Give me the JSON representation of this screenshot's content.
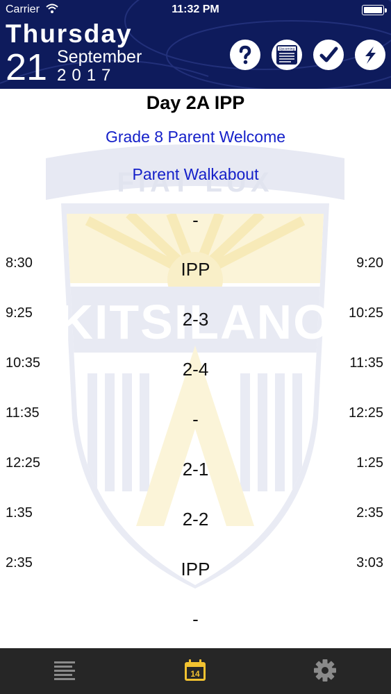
{
  "status_bar": {
    "carrier": "Carrier",
    "time": "11:32 PM"
  },
  "header": {
    "day_name": "Thursday",
    "day_number": "21",
    "month": "September",
    "year": "2017",
    "buttons": [
      {
        "icon": "help-icon"
      },
      {
        "icon": "upcoming-icon",
        "label": "Upcoming"
      },
      {
        "icon": "checkmark-icon"
      },
      {
        "icon": "lightning-icon"
      }
    ],
    "background_color": "#0e1b5c"
  },
  "schedule": {
    "day_title": "Day 2A IPP",
    "events": [
      "Grade 8 Parent Welcome",
      "Parent Walkabout"
    ],
    "opening_label": "-",
    "slots": [
      {
        "start": "8:30",
        "label": "IPP",
        "end": "9:20"
      },
      {
        "start": "9:25",
        "label": "2-3",
        "end": "10:25"
      },
      {
        "start": "10:35",
        "label": "2-4",
        "end": "11:35"
      },
      {
        "start": "11:35",
        "label": "-",
        "end": "12:25"
      },
      {
        "start": "12:25",
        "label": "2-1",
        "end": "1:25"
      },
      {
        "start": "1:35",
        "label": "2-2",
        "end": "2:35"
      },
      {
        "start": "2:35",
        "label": "IPP",
        "end": "3:03"
      }
    ],
    "closing_label": "-",
    "event_color": "#1520c9"
  },
  "watermark": {
    "motto": "FIAT LUX",
    "school": "KITSILANO"
  },
  "tabbar": {
    "items": [
      {
        "icon": "list-icon",
        "active": false
      },
      {
        "icon": "calendar-icon",
        "label": "14",
        "active": true
      },
      {
        "icon": "gear-icon",
        "active": false
      }
    ],
    "active_color": "#f2c230",
    "inactive_color": "#8a8a8a"
  }
}
